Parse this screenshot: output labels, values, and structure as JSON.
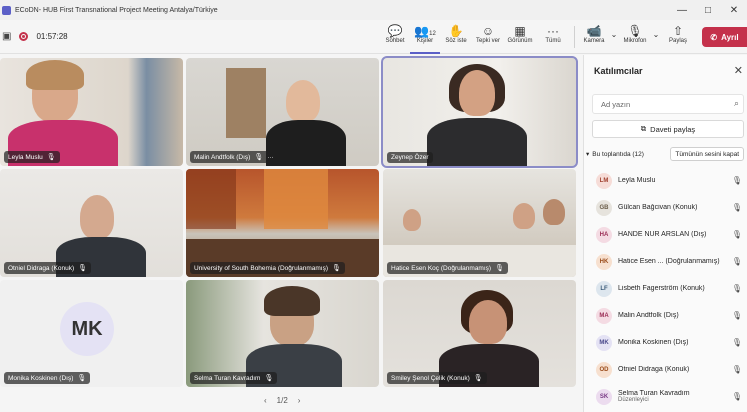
{
  "window": {
    "title": "ECoDN- HUB First Transnational Project Meeting Antalya/Türkiye",
    "controls": [
      "—",
      "□",
      "✕"
    ]
  },
  "toolbar": {
    "timer": "01:57:28",
    "buttons": [
      {
        "label": "Sohbet",
        "icon": "💬"
      },
      {
        "label": "Kişiler",
        "icon": "👥",
        "count": "12"
      },
      {
        "label": "Söz iste",
        "icon": "✋"
      },
      {
        "label": "Tepki ver",
        "icon": "☺"
      },
      {
        "label": "Görünüm",
        "icon": "▦"
      },
      {
        "label": "Tümü",
        "icon": "···"
      },
      {
        "label": "Kamera",
        "icon": "📹"
      },
      {
        "label": "Mikrofon",
        "icon": "🎙"
      },
      {
        "label": "Paylaş",
        "icon": "⇧"
      }
    ],
    "leave_label": "Ayrıl"
  },
  "tiles": [
    {
      "name": "Leyla Muslu"
    },
    {
      "name": "Malin Andtfolk (Dış)"
    },
    {
      "name": "Zeynep Özer"
    },
    {
      "name": "Otniel Didraga (Konuk)"
    },
    {
      "name": "University of South Bohemia (Doğrulanmamış)"
    },
    {
      "name": "Hatice Esen Koç (Doğrulanmamış)"
    },
    {
      "name": "Monika Koskinen (Dış)",
      "initials": "MK"
    },
    {
      "name": "Selma Turan Kavradım"
    },
    {
      "name": "Smiley Şenol Çelik (Konuk)"
    }
  ],
  "pager": {
    "text": "1/2"
  },
  "panel": {
    "title": "Katılımcılar",
    "search_placeholder": "Ad yazın",
    "invite_label": "Daveti paylaş",
    "section_label": "Bu toplantıda (12)",
    "mute_all_label": "Tümünün sesini kapat",
    "participants": [
      {
        "initials": "LM",
        "name": "Leyla Muslu",
        "color": "#f6dcd7"
      },
      {
        "initials": "GB",
        "name": "Gülcan Bağcivan (Konuk)",
        "color": "#e6e3dd"
      },
      {
        "initials": "HA",
        "name": "HANDE NUR ARSLAN (Dış)",
        "color": "#f4dbe3"
      },
      {
        "initials": "HK",
        "name": "Hatice Esen ...   (Doğrulanmamış)",
        "color": "#f7e0cf"
      },
      {
        "initials": "LF",
        "name": "Lisbeth Fagerström (Konuk)",
        "color": "#dde6ee"
      },
      {
        "initials": "MA",
        "name": "Malin Andtfolk (Dış)",
        "color": "#f4dbe3"
      },
      {
        "initials": "MK",
        "name": "Monika Koskinen (Dış)",
        "color": "#e4e2f4"
      },
      {
        "initials": "OD",
        "name": "Otniel Didraga (Konuk)",
        "color": "#f7e0cf"
      },
      {
        "initials": "SK",
        "name": "Selma Turan Kavradım",
        "sub": "Düzenleyici",
        "color": "#ecdcef"
      }
    ]
  }
}
